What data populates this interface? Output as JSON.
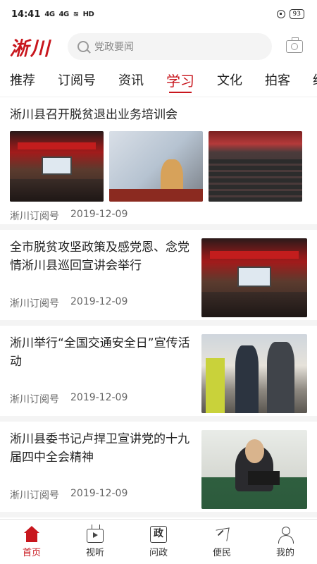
{
  "status_bar": {
    "time": "14:41",
    "signal_1": "4G",
    "signal_2": "4G",
    "network": "HD",
    "battery": "93"
  },
  "header": {
    "logo": "淅川",
    "search_placeholder": "党政要闻"
  },
  "tabs": [
    {
      "label": "推荐"
    },
    {
      "label": "订阅号"
    },
    {
      "label": "资讯"
    },
    {
      "label": "学习",
      "active": true
    },
    {
      "label": "文化"
    },
    {
      "label": "拍客"
    },
    {
      "label": "经济"
    }
  ],
  "articles": [
    {
      "title": "淅川县召开脱贫退出业务培训会",
      "source": "淅川订阅号",
      "date": "2019-12-09"
    },
    {
      "title": "全市脱贫攻坚政策及感党恩、念党情淅川县巡回宣讲会举行",
      "source": "淅川订阅号",
      "date": "2019-12-09"
    },
    {
      "title": "淅川举行“全国交通安全日”宣传活动",
      "source": "淅川订阅号",
      "date": "2019-12-09"
    },
    {
      "title": "淅川县委书记卢捍卫宣讲党的十九届四中全会精神",
      "source": "淅川订阅号",
      "date": "2019-12-09"
    }
  ],
  "bottom_nav": [
    {
      "label": "首页",
      "icon": "home-icon",
      "active": true
    },
    {
      "label": "视听",
      "icon": "tv-icon"
    },
    {
      "label": "问政",
      "icon": "zheng-icon",
      "icon_text": "政"
    },
    {
      "label": "便民",
      "icon": "send-icon"
    },
    {
      "label": "我的",
      "icon": "user-icon"
    }
  ],
  "colors": {
    "brand": "#c8161d",
    "divider": "#f4f4f4"
  }
}
